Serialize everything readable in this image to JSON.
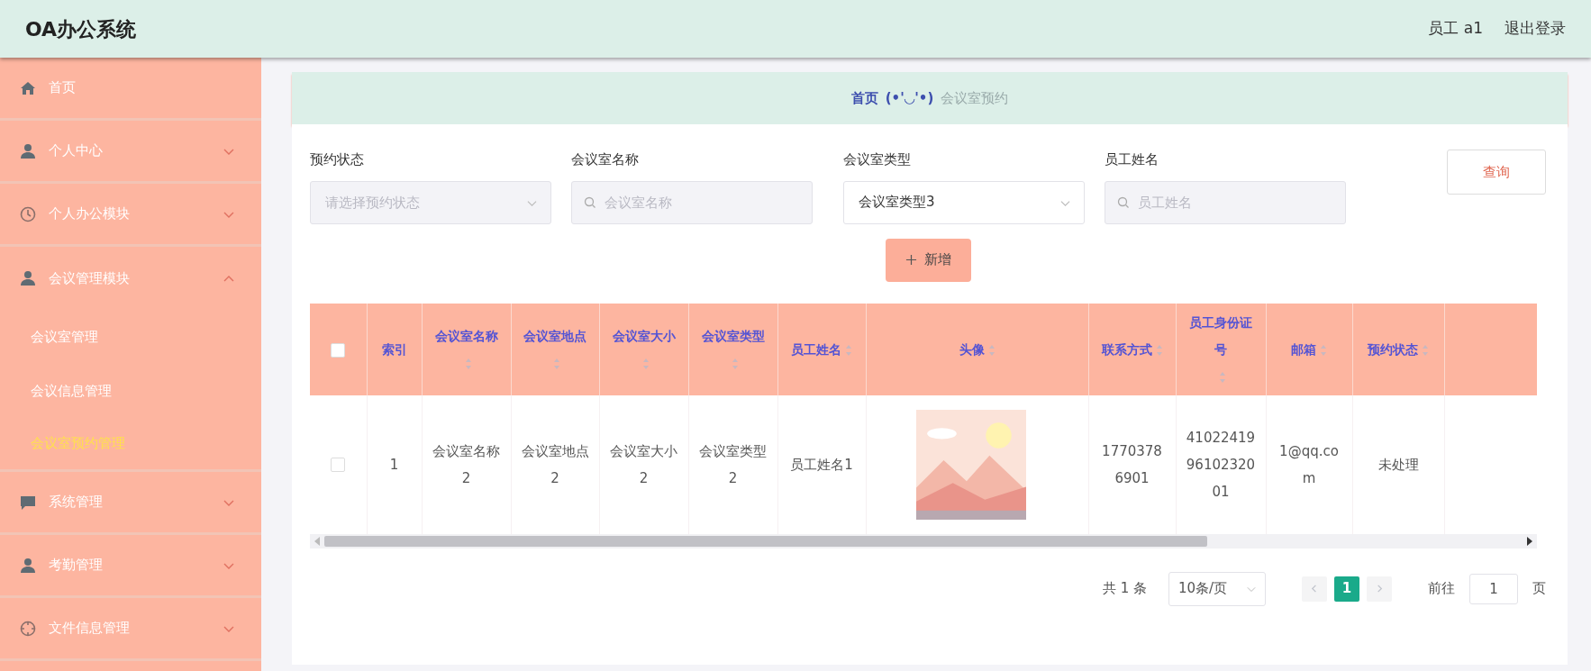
{
  "header": {
    "title": "OA办公系统",
    "user": "员工 a1",
    "logout": "退出登录"
  },
  "sidebar": {
    "items": [
      {
        "label": "首页",
        "kind": "link"
      },
      {
        "label": "个人中心",
        "kind": "menu",
        "expanded": false
      },
      {
        "label": "个人办公模块",
        "kind": "menu",
        "expanded": false
      },
      {
        "label": "会议管理模块",
        "kind": "menu",
        "expanded": true,
        "children": [
          {
            "label": "会议室管理",
            "selected": false
          },
          {
            "label": "会议信息管理",
            "selected": false
          },
          {
            "label": "会议室预约管理",
            "selected": true
          }
        ]
      },
      {
        "label": "系统管理",
        "kind": "menu",
        "expanded": false
      },
      {
        "label": "考勤管理",
        "kind": "menu",
        "expanded": false
      },
      {
        "label": "文件信息管理",
        "kind": "menu",
        "expanded": false
      }
    ]
  },
  "breadcrumb": {
    "home": "首页",
    "separator": "(•'◡'•)",
    "current": "会议室预约"
  },
  "filters": [
    {
      "label": "预约状态",
      "kind": "select",
      "placeholder": "请选择预约状态"
    },
    {
      "label": "会议室名称",
      "kind": "search",
      "placeholder": "会议室名称"
    },
    {
      "label": "会议室类型",
      "kind": "select",
      "value": "会议室类型3"
    },
    {
      "label": "员工姓名",
      "kind": "search",
      "placeholder": "员工姓名"
    }
  ],
  "query_button": "查询",
  "add_button": "新增",
  "table": {
    "columns": [
      {
        "label": "索引",
        "sortable": false
      },
      {
        "label": "会议室名称",
        "sortable": true
      },
      {
        "label": "会议室地点",
        "sortable": true
      },
      {
        "label": "会议室大小",
        "sortable": true
      },
      {
        "label": "会议室类型",
        "sortable": true
      },
      {
        "label": "员工姓名",
        "sortable": true
      },
      {
        "label": "头像",
        "sortable": true
      },
      {
        "label": "联系方式",
        "sortable": true
      },
      {
        "label": "员工身份证号",
        "sortable": true
      },
      {
        "label": "邮箱",
        "sortable": true
      },
      {
        "label": "预约状态",
        "sortable": true
      }
    ],
    "all_checked": false,
    "rows": [
      {
        "checked": false,
        "cells": [
          "1",
          "会议室名称2",
          "会议室地点2",
          "会议室大小2",
          "会议室类型2",
          "员工姓名1",
          {
            "kind": "picture"
          },
          "17703786901",
          "410224199610232001",
          "1@qq.com",
          "未处理"
        ]
      }
    ]
  },
  "pagination": {
    "total": "共 1 条",
    "page_size": "10条/页",
    "pages": [
      {
        "label": "1",
        "selected": true
      }
    ],
    "goto_label": "前往",
    "goto_value": "1",
    "page_suffix": "页"
  }
}
